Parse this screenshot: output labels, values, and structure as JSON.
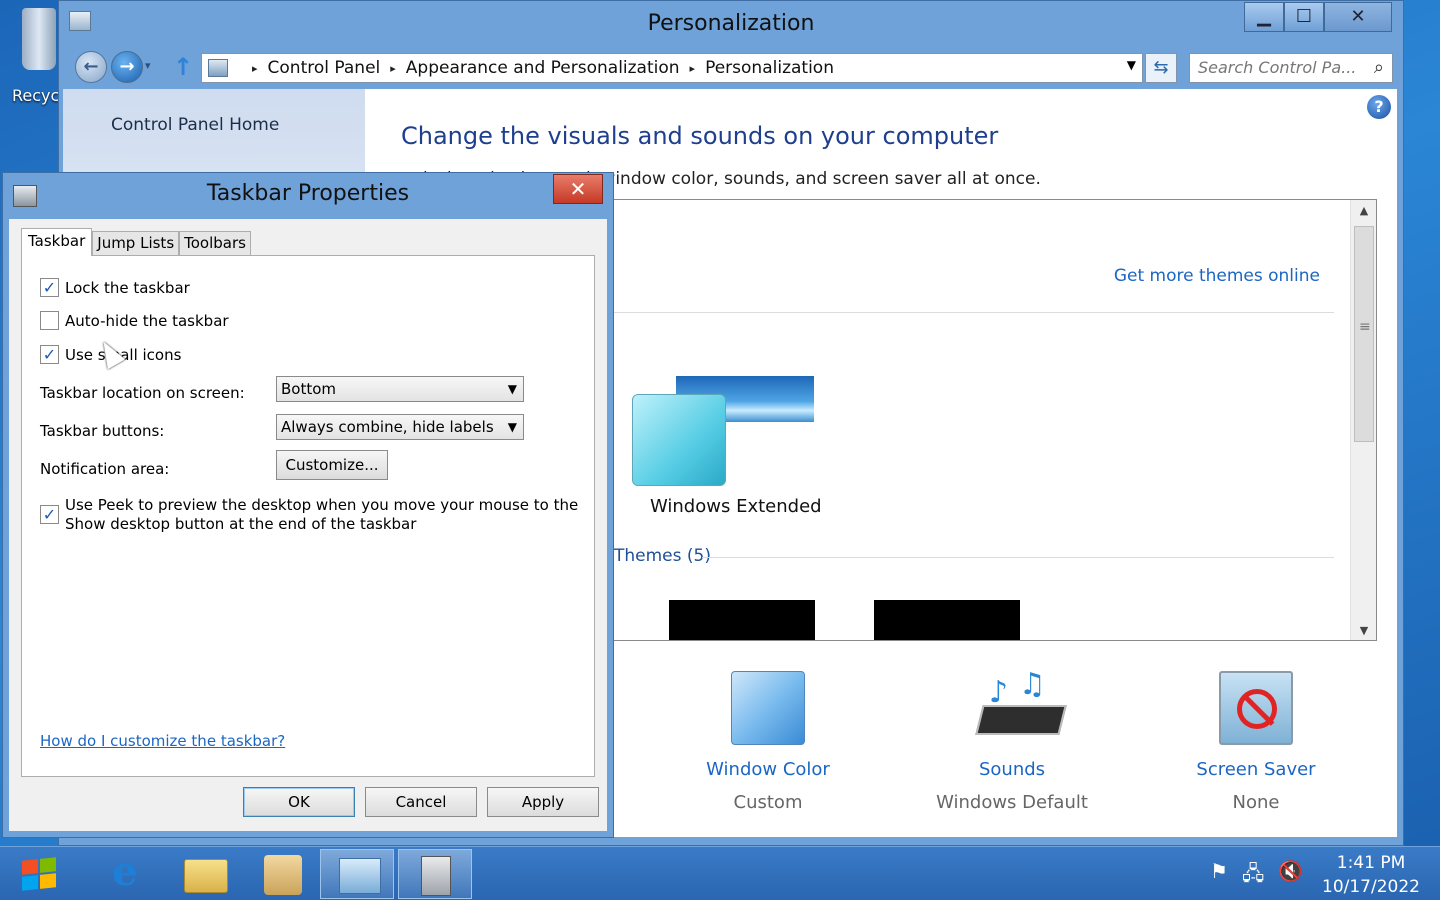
{
  "desktop": {
    "recycle_label": "Recyc"
  },
  "window": {
    "title": "Personalization",
    "min_glyph": "▁",
    "max_glyph": "☐",
    "close_glyph": "✕",
    "nav": {
      "back_glyph": "←",
      "forward_glyph": "→",
      "dropdown_glyph": "▾",
      "up_glyph": "↑",
      "refresh_glyph": "⇆"
    },
    "breadcrumb": [
      "Control Panel",
      "Appearance and Personalization",
      "Personalization"
    ],
    "breadcrumb_sep": "▸",
    "address_dropdown_glyph": "▼",
    "search": {
      "placeholder": "Search Control Pa...",
      "icon_glyph": "⌕"
    },
    "left_pane": {
      "home_link": "Control Panel Home"
    },
    "help_glyph": "?",
    "heading": "Change the visuals and sounds on your computer",
    "subtext": "e desktop background, window color, sounds, and screen saver all at once.",
    "themes": {
      "get_more_link": "Get more themes online",
      "selected_theme_name": "Windows Extended",
      "section_label": "Themes (5)",
      "scroll_up_glyph": "▲",
      "scroll_down_glyph": "▼"
    },
    "bottom_items": [
      {
        "label": "Window Color",
        "value": "Custom"
      },
      {
        "label": "Sounds",
        "value": "Windows Default"
      },
      {
        "label": "Screen Saver",
        "value": "None"
      }
    ]
  },
  "dialog": {
    "title": "Taskbar Properties",
    "close_glyph": "✕",
    "tabs": [
      "Taskbar",
      "Jump Lists",
      "Toolbars"
    ],
    "options": {
      "lock_taskbar": {
        "label": "Lock the taskbar",
        "checked": true
      },
      "auto_hide": {
        "label": "Auto-hide the taskbar",
        "checked": false
      },
      "small_icons": {
        "label": "Use small icons",
        "checked": true
      }
    },
    "check_glyph": "✓",
    "location_label": "Taskbar location on screen:",
    "location_value": "Bottom",
    "buttons_label": "Taskbar buttons:",
    "buttons_value": "Always combine, hide labels",
    "notification_label": "Notification area:",
    "customize_button": "Customize...",
    "peek_label_line1": "Use Peek to preview the desktop when you move your mouse to the",
    "peek_label_line2": "Show desktop button at the end of the taskbar",
    "peek_checked": true,
    "help_link": "How do I customize the taskbar?",
    "ok": "OK",
    "cancel": "Cancel",
    "apply": "Apply",
    "combo_arrow": "▼"
  },
  "taskbar": {
    "ie_glyph": "e",
    "tray": {
      "flag_glyph": "⚑",
      "network_glyph": "🖧",
      "volume_glyph": "🔇"
    },
    "time": "1:41 PM",
    "date": "10/17/2022"
  }
}
